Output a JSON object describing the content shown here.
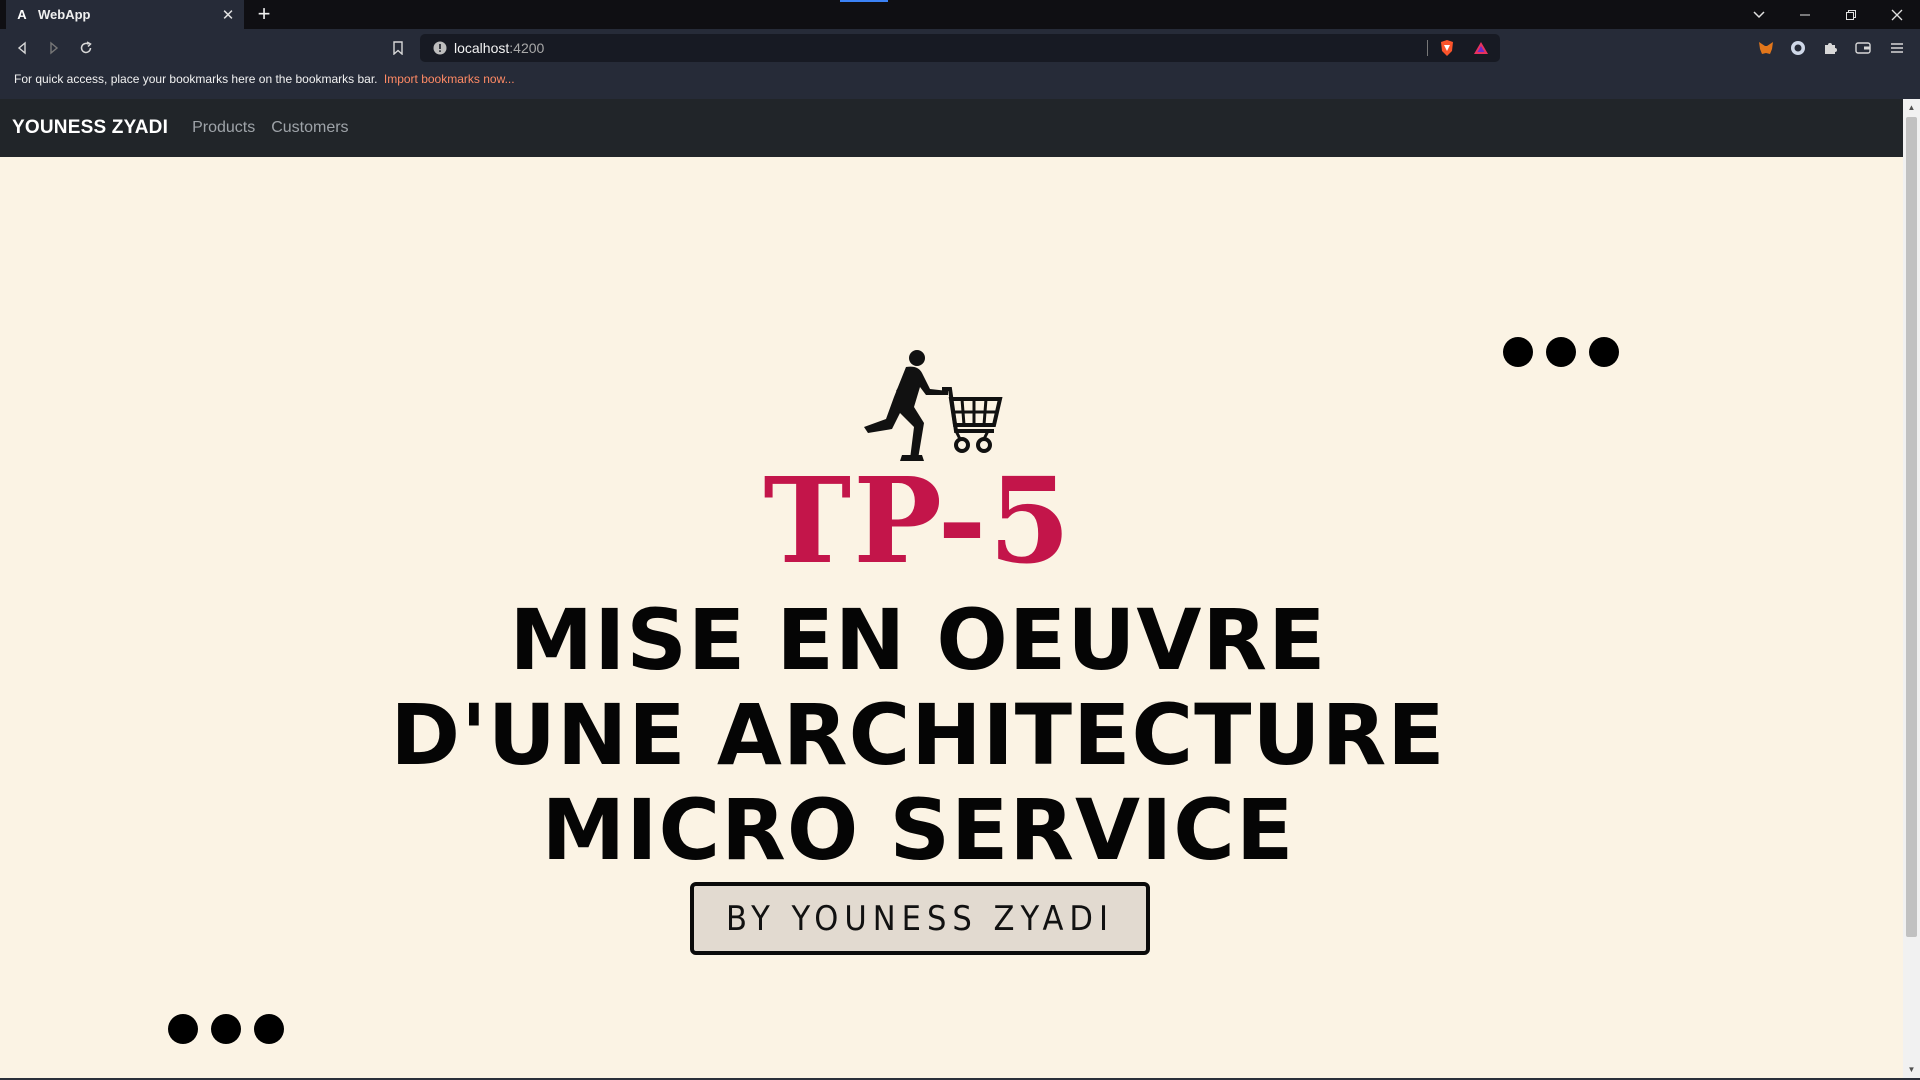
{
  "browser": {
    "tab_title": "WebApp",
    "tab_favicon": "A",
    "url_host": "localhost",
    "url_port": ":4200",
    "bookmark_hint": "For quick access, place your bookmarks here on the bookmarks bar.",
    "bookmark_import_link": "Import bookmarks now..."
  },
  "app": {
    "brand": "YOUNESS ZYADI",
    "nav_links": [
      "Products",
      "Customers"
    ]
  },
  "hero": {
    "tp_label": "TP-5",
    "headline_lines": [
      "MISE EN OEUVRE",
      "D'UNE ARCHITECTURE",
      "MICRO SERVICE"
    ],
    "byline": "BY YOUNESS ZYADI",
    "illustration": "man-pushing-shopping-cart",
    "accent_color": "#c3154a",
    "background_color": "#fbf3e4"
  }
}
